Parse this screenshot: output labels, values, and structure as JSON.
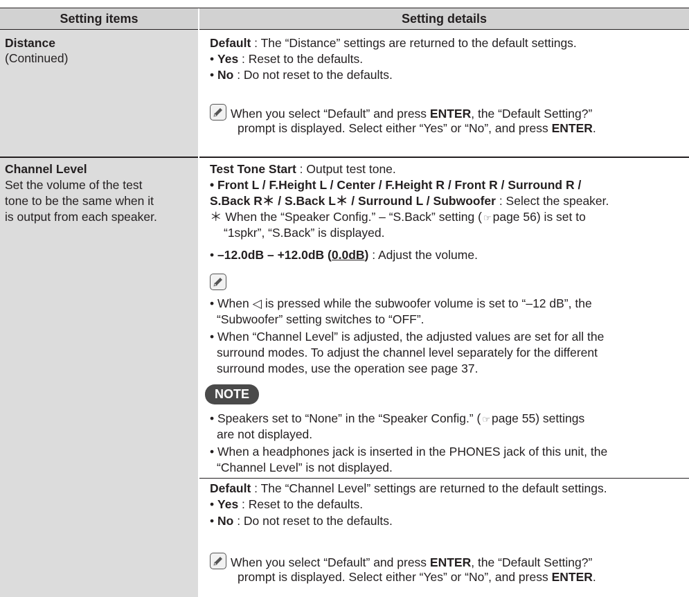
{
  "header": {
    "col1": "Setting items",
    "col2": "Setting details"
  },
  "distance": {
    "title": "Distance",
    "sub": "(Continued)",
    "default_label": "Default",
    "default_text": " : The “Distance” settings are returned to the default settings.",
    "yes_label": "Yes",
    "yes_text": " : Reset to the defaults.",
    "no_label": "No",
    "no_text": " : Do not reset to the defaults.",
    "note_l1_a": "When you select “Default” and press ",
    "note_enter": "ENTER",
    "note_l1_b": ", the “Default Setting?”",
    "note_l2_a": "prompt is displayed. Select either “Yes” or “No”, and press ",
    "note_l2_b": "."
  },
  "channel": {
    "title": "Channel Level",
    "desc1": "Set the volume of the test",
    "desc2": "tone to be the same when it",
    "desc3": "is output from each speaker.",
    "tts_label": "Test Tone Start",
    "tts_text": " : Output test tone.",
    "spk_line1": "Front L  / F.Height L / Center / F.Height R / Front R / Surround R /",
    "spk_line2_bold": "S.Back R＊ / S.Back L＊ / Surround L / Subwoofer",
    "spk_line2_text": " : Select the speaker.",
    "ast_line1_a": "＊ When the “Speaker Config.” – “S.Back” setting (",
    "ast_line1_b": "page 56) is set to",
    "ast_line2": "“1spkr”, “S.Back” is displayed.",
    "range_bold": "–12.0dB – +12.0dB (",
    "range_default": "0.0dB",
    "range_close": ")",
    "range_text": " : Adjust the volume.",
    "tip1_a": "When ",
    "tip1_b": " is pressed while the subwoofer volume is set to “–12 dB”, the",
    "tip1_c": "“Subwoofer” setting switches to “OFF”.",
    "tip2_a": "When “Channel Level” is adjusted, the adjusted values are set for all the",
    "tip2_b": "surround modes. To adjust the channel level separately for the different",
    "tip2_c": "surround modes, use the operation see page 37.",
    "note_badge": "NOTE",
    "note1_a": "Speakers set to “None” in the “Speaker Config.” (",
    "note1_b": "page 55) settings",
    "note1_c": "are not displayed.",
    "note2_a": "When a headphones jack is inserted in the PHONES jack of this unit, the",
    "note2_b": "“Channel Level” is not displayed.",
    "default_label": "Default",
    "default_text": " : The “Channel Level” settings are returned to the default settings.",
    "yes_label": "Yes",
    "yes_text": " : Reset to the defaults.",
    "no_label": "No",
    "no_text": " : Do not reset to the defaults.",
    "note_l1_a": "When you select “Default” and press ",
    "note_enter": "ENTER",
    "note_l1_b": ", the “Default Setting?”",
    "note_l2_a": "prompt is displayed. Select either “Yes” or “No”, and press ",
    "note_l2_b": "."
  },
  "icons": {
    "pencil": "pencil-note-icon",
    "reference": "reference-hand-icon",
    "left_arrow": "left-triangle-icon"
  },
  "colors": {
    "header_bg": "#d2d2d2",
    "col1_bg": "#dcdcdc",
    "note_badge_bg": "#4a4a4a",
    "text": "#231f20"
  }
}
